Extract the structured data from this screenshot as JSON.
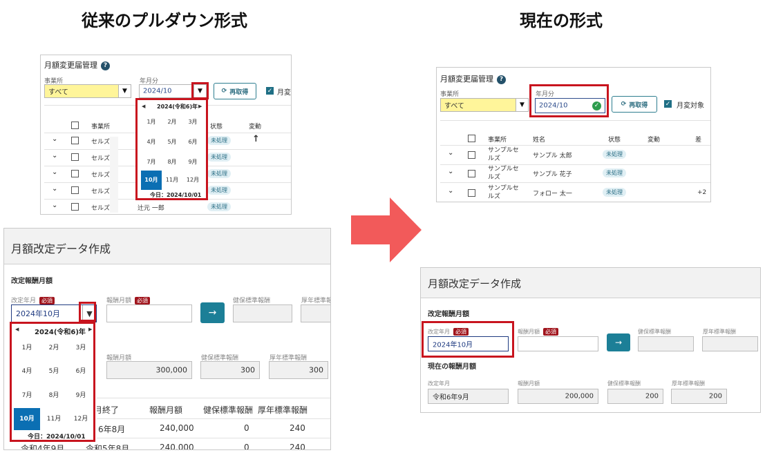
{
  "headings": {
    "left": "従来のプルダウン形式",
    "right": "現在の形式"
  },
  "colors": {
    "highlight_red": "#c8141e",
    "arrow": "#f25a5a",
    "accent": "#1c7f97",
    "selected_month": "#0b6fb3"
  },
  "old_list": {
    "title": "月額変更届管理",
    "office_label": "事業所",
    "office_value": "すべて",
    "month_label": "年月分",
    "month_value": "2024/10",
    "dropdown_glyph": "▼",
    "refetch": "再取得",
    "monthly_toggle": "月変",
    "columns": {
      "office": "事業所",
      "status": "状態",
      "change": "変動"
    },
    "rows": [
      {
        "office": "セルズ",
        "name": "",
        "status": "未処理",
        "change": "↑"
      },
      {
        "office": "セルズ",
        "name": "",
        "status": "未処理",
        "change": ""
      },
      {
        "office": "セルズ",
        "name": "",
        "status": "未処理",
        "change": ""
      },
      {
        "office": "セルズ",
        "name": "",
        "status": "未処理",
        "change": ""
      },
      {
        "office": "セルズ",
        "name": "辻元 一郎",
        "status": "未処理",
        "change": ""
      }
    ],
    "calendar": {
      "year": "2024(令和6)年",
      "months": [
        "1月",
        "2月",
        "3月",
        "4月",
        "5月",
        "6月",
        "7月",
        "8月",
        "9月",
        "10月",
        "11月",
        "12月"
      ],
      "selected": "10月",
      "today": "今日：2024/10/01"
    }
  },
  "old_form": {
    "title": "月額改定データ作成",
    "section": "改定報酬月額",
    "field_month_label": "改定年月",
    "required": "必須",
    "field_month_value": "2024年10月",
    "dropdown_glyph": "▼",
    "field_salary_label": "報酬月額",
    "go": "→",
    "health_label": "健保標準報酬",
    "pension_label": "厚年標準報酬",
    "current_salary_label": "報酬月額",
    "current_salary_value": "300,000",
    "current_health_label": "健保標準報酬",
    "current_health_value": "300",
    "current_pension_label": "厚年標準報酬",
    "current_pension_value": "300",
    "table_headers": [
      "年月終了",
      "報酬月額",
      "健保標準報酬",
      "厚年標準報酬"
    ],
    "table_rows": [
      {
        "end": "6年8月",
        "salary": "240,000",
        "health": "0",
        "pension": "240"
      },
      {
        "start": "令和4年9月",
        "end": "令和5年8月",
        "salary": "240,000",
        "health": "0",
        "pension": "240"
      }
    ],
    "calendar": {
      "year": "2024(令和6)年",
      "months": [
        "1月",
        "2月",
        "3月",
        "4月",
        "5月",
        "6月",
        "7月",
        "8月",
        "9月",
        "10月",
        "11月",
        "12月"
      ],
      "selected": "10月",
      "today": "今日：2024/10/01"
    }
  },
  "new_list": {
    "title": "月額変更届管理",
    "office_label": "事業所",
    "office_value": "すべて",
    "month_label": "年月分",
    "month_value": "2024/10",
    "refetch": "再取得",
    "monthly_toggle": "月変対象",
    "columns": {
      "office": "事業所",
      "name": "姓名",
      "status": "状態",
      "change": "変動",
      "diff": "差"
    },
    "rows": [
      {
        "office": "サンプルセルズ",
        "name": "サンプル 太郎",
        "status": "未処理",
        "diff": ""
      },
      {
        "office": "サンプルセルズ",
        "name": "サンプル 花子",
        "status": "未処理",
        "diff": ""
      },
      {
        "office": "サンプルセルズ",
        "name": "フォロー 太一",
        "status": "未処理",
        "diff": "+2"
      }
    ]
  },
  "new_form": {
    "title": "月額改定データ作成",
    "section": "改定報酬月額",
    "field_month_label": "改定年月",
    "required": "必須",
    "field_month_value": "2024年10月",
    "field_salary_label": "報酬月額",
    "go": "→",
    "health_label": "健保標準報酬",
    "pension_label": "厚年標準報酬",
    "current_section": "現在の報酬月額",
    "current_month_label": "改定年月",
    "current_month_value": "令和6年9月",
    "current_salary_label": "報酬月額",
    "current_salary_value": "200,000",
    "current_health_label": "健保標準報酬",
    "current_health_value": "200",
    "current_pension_label": "厚年標準報酬",
    "current_pension_value": "200"
  }
}
